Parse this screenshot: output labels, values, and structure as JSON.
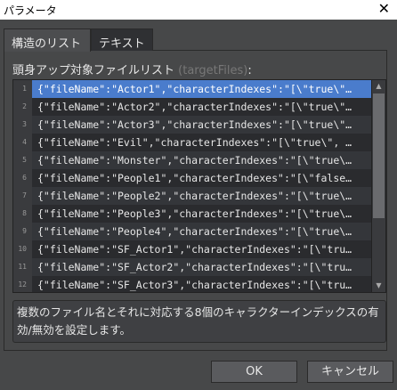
{
  "window": {
    "title": "パラメータ",
    "close": "✕"
  },
  "tabs": [
    {
      "label": "構造のリスト"
    },
    {
      "label": "テキスト"
    }
  ],
  "field": {
    "label": "頭身アップ対象ファイルリスト",
    "key": "(targetFiles)",
    "colon": ":"
  },
  "rows": [
    {
      "n": "1",
      "t": "{\"fileName\":\"Actor1\",\"characterIndexes\":\"[\\\"true\\\"…"
    },
    {
      "n": "2",
      "t": "{\"fileName\":\"Actor2\",\"characterIndexes\":\"[\\\"true\\\"…"
    },
    {
      "n": "3",
      "t": "{\"fileName\":\"Actor3\",\"characterIndexes\":\"[\\\"true\\\"…"
    },
    {
      "n": "4",
      "t": "{\"fileName\":\"Evil\",\"characterIndexes\":\"[\\\"true\\\", …"
    },
    {
      "n": "5",
      "t": "{\"fileName\":\"Monster\",\"characterIndexes\":\"[\\\"true\\…"
    },
    {
      "n": "6",
      "t": "{\"fileName\":\"People1\",\"characterIndexes\":\"[\\\"false…"
    },
    {
      "n": "7",
      "t": "{\"fileName\":\"People2\",\"characterIndexes\":\"[\\\"true\\…"
    },
    {
      "n": "8",
      "t": "{\"fileName\":\"People3\",\"characterIndexes\":\"[\\\"true\\…"
    },
    {
      "n": "9",
      "t": "{\"fileName\":\"People4\",\"characterIndexes\":\"[\\\"true\\…"
    },
    {
      "n": "10",
      "t": "{\"fileName\":\"SF_Actor1\",\"characterIndexes\":\"[\\\"tru…"
    },
    {
      "n": "11",
      "t": "{\"fileName\":\"SF_Actor2\",\"characterIndexes\":\"[\\\"tru…"
    },
    {
      "n": "12",
      "t": "{\"fileName\":\"SF_Actor3\",\"characterIndexes\":\"[\\\"tru…"
    }
  ],
  "description": "複数のファイル名とそれに対応する8個のキャラクターインデックスの有効/無効を設定します。",
  "buttons": {
    "ok": "OK",
    "cancel": "キャンセル"
  },
  "scroll": {
    "up": "▲",
    "down": "▼"
  }
}
